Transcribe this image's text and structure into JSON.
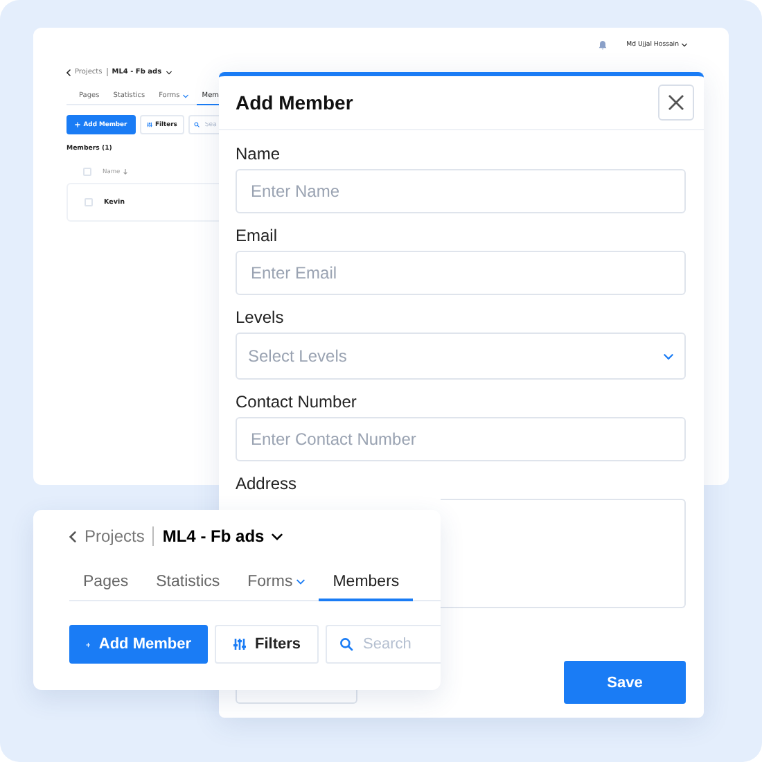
{
  "back_window": {
    "user_name": "Md Ujjal Hossain",
    "breadcrumb": {
      "parent": "Projects",
      "current": "ML4 - Fb ads"
    },
    "tabs": [
      {
        "label": "Pages",
        "selected": false,
        "dropdown": false
      },
      {
        "label": "Statistics",
        "selected": false,
        "dropdown": false
      },
      {
        "label": "Forms",
        "selected": false,
        "dropdown": true
      },
      {
        "label": "Mem",
        "selected": true,
        "dropdown": false
      }
    ],
    "add_button": "Add Member",
    "filters_button": "Filters",
    "search": {
      "placeholder": "Sea"
    },
    "members_heading": "Members (1)",
    "table": {
      "header_checked": false,
      "columns": [
        "Name"
      ],
      "rows": [
        {
          "name": "Kevin",
          "checked": false
        }
      ]
    }
  },
  "modal": {
    "title": "Add Member",
    "fields": [
      {
        "kind": "input",
        "label": "Name",
        "placeholder": "Enter Name"
      },
      {
        "kind": "input",
        "label": "Email",
        "placeholder": "Enter Email"
      },
      {
        "kind": "select",
        "label": "Levels",
        "placeholder": "Select Levels"
      },
      {
        "kind": "input",
        "label": "Contact Number",
        "placeholder": "Enter Contact Number"
      },
      {
        "kind": "textarea",
        "label": "Address"
      }
    ],
    "save_button": "Save"
  },
  "front_card": {
    "breadcrumb": {
      "parent": "Projects",
      "current": "ML4 - Fb ads"
    },
    "tabs": [
      {
        "label": "Pages",
        "selected": false,
        "dropdown": false
      },
      {
        "label": "Statistics",
        "selected": false,
        "dropdown": false
      },
      {
        "label": "Forms",
        "selected": false,
        "dropdown": true
      },
      {
        "label": "Members",
        "selected": true,
        "dropdown": false
      }
    ],
    "add_button": "Add Member",
    "filters_button": "Filters",
    "search": {
      "placeholder": "Search"
    }
  }
}
